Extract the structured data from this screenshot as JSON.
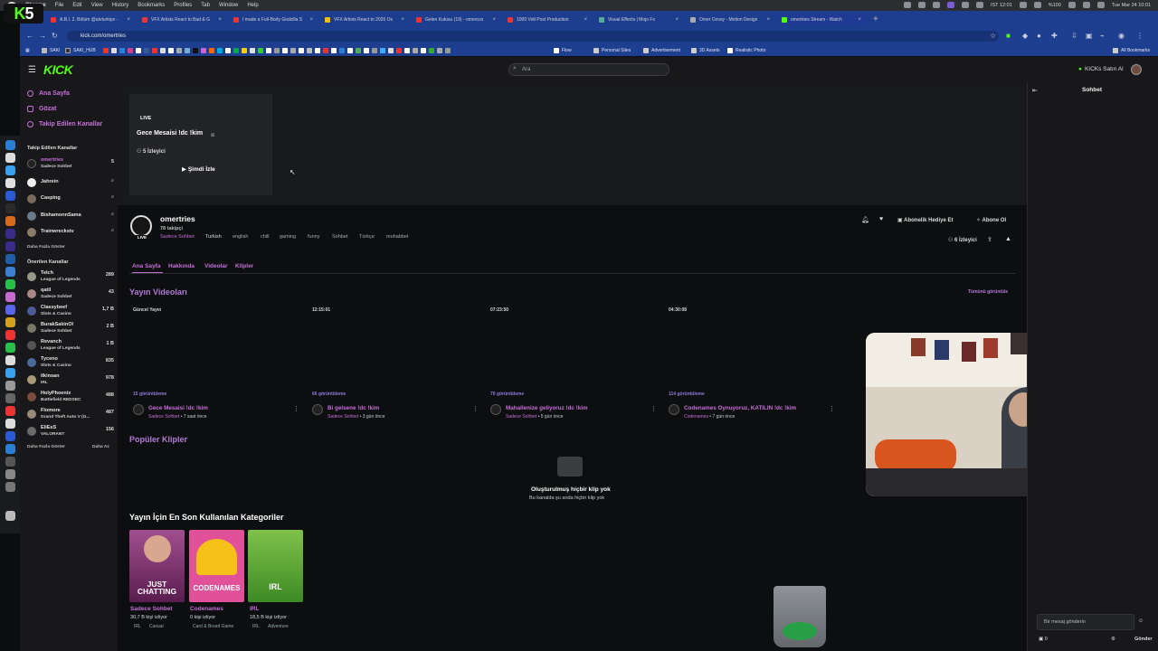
{
  "menubar": {
    "app": "Chrome",
    "items": [
      "File",
      "Edit",
      "View",
      "History",
      "Bookmarks",
      "Profiles",
      "Tab",
      "Window",
      "Help"
    ],
    "battery": "%100",
    "clock1": "IST 12:01",
    "clock2": "Tue Mar 24  10:01"
  },
  "overlay_logo": {
    "k": "K",
    "num": "5"
  },
  "tabs": [
    {
      "label": "A.B.I. 2. Bölüm @atvturkiye -",
      "color": "#e33"
    },
    {
      "label": "VFX Artists React to Bad & G",
      "color": "#e33"
    },
    {
      "label": "I made a Full-Body Godzilla S",
      "color": "#e33"
    },
    {
      "label": "VFX Artists React to 2026 Os",
      "color": "#f2c200"
    },
    {
      "label": "Gelen Kutusu (19) - omerozs",
      "color": "#e33"
    },
    {
      "label": "1000 Volt Post Production",
      "color": "#e33"
    },
    {
      "label": "Visual Effects | Mojo Fx",
      "color": "#5a9"
    },
    {
      "label": "Omer Ozsoy - Motion Design",
      "color": "#aaa"
    },
    {
      "label": "omertries Stream - Watch",
      "color": "#53fc18",
      "active": true
    }
  ],
  "url": "kick.com/omertries",
  "bookmarks": {
    "items": [
      "SAKI",
      "SAKI_HUB",
      "Flow",
      "Personal Sites",
      "Advertisement",
      "3D Assets",
      "Realistic Photo"
    ],
    "all": "All Bookmarks"
  },
  "kick": {
    "logo": "KICK",
    "search_placeholder": "Ara",
    "buy_kicks": "KICKs Satın Al"
  },
  "sidebar": {
    "nav": [
      {
        "label": "Ana Sayfa"
      },
      {
        "label": "Gözat"
      },
      {
        "label": "Takip Edilen Kanallar"
      }
    ],
    "followed_title": "Takip Edilen Kanallar",
    "followed": [
      {
        "name": "omertries",
        "sub": "Sadece Sohbet",
        "count": "5",
        "live": true,
        "highlight": true
      },
      {
        "name": "Jahrein",
        "sub": "",
        "count": "",
        "live": false
      },
      {
        "name": "Casping",
        "sub": "",
        "count": "",
        "live": false
      },
      {
        "name": "BishamonnSama",
        "sub": "",
        "count": "",
        "live": false
      },
      {
        "name": "Trainwreckstv",
        "sub": "",
        "count": "",
        "live": false
      }
    ],
    "show_more": "Daha Fazla Göster",
    "recommended_title": "Önerilen Kanallar",
    "recommended": [
      {
        "name": "Telch",
        "sub": "League of Legends",
        "count": "289"
      },
      {
        "name": "qatil",
        "sub": "Sadece Sohbet",
        "count": "43"
      },
      {
        "name": "Classybeef",
        "sub": "Slots & Casino",
        "count": "1,7 B"
      },
      {
        "name": "BurakSakinOl",
        "sub": "Sadece Sohbet",
        "count": "2 B"
      },
      {
        "name": "Revanch",
        "sub": "League of Legends",
        "count": "1 B"
      },
      {
        "name": "Tyceno",
        "sub": "Slots & Casino",
        "count": "835"
      },
      {
        "name": "ilkinsan",
        "sub": "IRL",
        "count": "978"
      },
      {
        "name": "HolyPhoenix",
        "sub": "Battlefield REDSEC",
        "count": "488"
      },
      {
        "name": "Flomore",
        "sub": "Grand Theft Auto V (G...",
        "count": "487"
      },
      {
        "name": "EliEsS",
        "sub": "VALORANT",
        "count": "156"
      }
    ],
    "show_more2": "Daha Fazla Göster",
    "show_less": "Daha Az"
  },
  "live_card": {
    "badge": "LIVE",
    "title": "Gece Mesaisi !dc !kim",
    "viewers": "5 İzleyici",
    "watch": "Şimdi İzle"
  },
  "channel": {
    "name": "omertries",
    "followers": "78 takipçi",
    "live_badge": "LIVE",
    "category": "Sadece Sohbet",
    "tags": [
      "Turkish",
      "english",
      "chill",
      "gaming",
      "funny",
      "Sohbet",
      "Türkçe",
      "muhabbet"
    ],
    "gift_sub": "Abonelik Hediye Et",
    "subscribe": "Abone Ol",
    "viewers": "6 İzleyici"
  },
  "channel_tabs": [
    "Ana Sayfa",
    "Hakkında",
    "Videolar",
    "Klipler"
  ],
  "videos": {
    "title": "Yayın Videoları",
    "see_all": "Tümünü görüntüle",
    "items": [
      {
        "badge": "Güncel Yayın",
        "views": "15 görüntüleme",
        "title": "Gece Mesaisi !dc !kim",
        "category": "Sadece Sohbet",
        "ago": "7 saat önce"
      },
      {
        "badge": "12:15:01",
        "views": "66 görüntüleme",
        "title": "Bi gelsene !dc !kim",
        "category": "Sadece Sohbet",
        "ago": "3 gün önce"
      },
      {
        "badge": "07:23:50",
        "views": "70 görüntüleme",
        "title": "Mahallenize geliyoruz !dc !kim",
        "category": "Sadece Sohbet",
        "ago": "5 gün önce"
      },
      {
        "badge": "04:30:08",
        "views": "114 görüntüleme",
        "title": "Codenames Oynuyoruz, KATILIN !dc !kim",
        "category": "Codenames",
        "ago": "7 gün önce"
      }
    ]
  },
  "clips": {
    "title": "Popüler Klipler",
    "empty_title": "Oluşturulmuş hiçbir klip yok",
    "empty_sub": "Bu kanalda şu anda hiçbir klip yok"
  },
  "categories": {
    "title": "Yayın İçin En Son Kullanılan Kategoriler",
    "items": [
      {
        "name": "Sadece Sohbet",
        "art": "JUST CHATTING",
        "views": "30,7 B kişi izliyor",
        "tags": [
          "IRL",
          "Casual"
        ],
        "bg": "#7a2e6b"
      },
      {
        "name": "Codenames",
        "art": "CODENAMES",
        "views": "0 kişi izliyor",
        "tags": [
          "Card & Board Game"
        ],
        "bg": "#d63f84"
      },
      {
        "name": "IRL",
        "art": "IRL",
        "views": "18,5 B kişi izliyor",
        "tags": [
          "IRL",
          "Adventure"
        ],
        "bg": "#4f9a2d"
      }
    ]
  },
  "chat": {
    "title": "Sohbet",
    "input_placeholder": "Bir mesaj gönderin",
    "send": "Gönder",
    "points": "0"
  }
}
